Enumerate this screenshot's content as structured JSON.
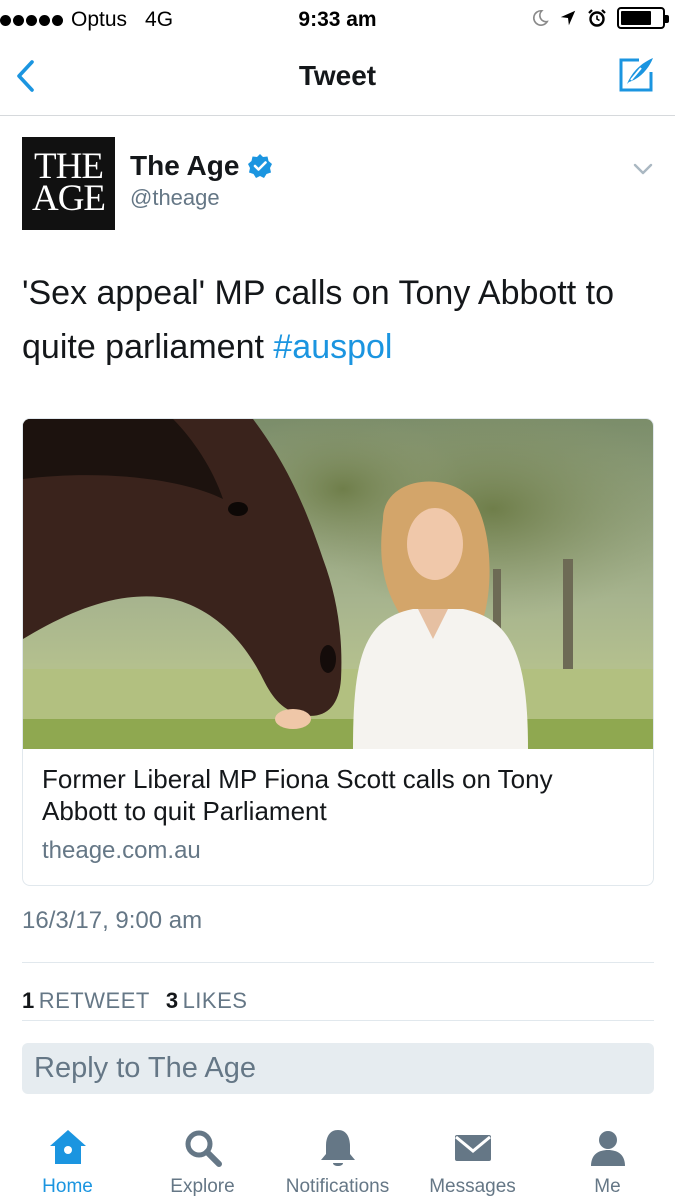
{
  "status_bar": {
    "carrier": "Optus",
    "network": "4G",
    "time": "9:33 am",
    "battery_level": 0.75,
    "icons": [
      "moon-icon",
      "location-arrow-icon",
      "alarm-icon",
      "battery-icon"
    ]
  },
  "nav": {
    "title": "Tweet",
    "back_icon": "chevron-left-icon",
    "compose_icon": "compose-icon"
  },
  "tweet": {
    "avatar_text_line1": "THE",
    "avatar_text_line2": "AGE",
    "author_name": "The Age",
    "author_handle": "@theage",
    "verified": true,
    "text_main": "'Sex appeal' MP calls on Tony Abbott to quite parliament",
    "hashtag": "#auspol",
    "timestamp": "16/3/17, 9:00 am",
    "retweet_count": "1",
    "retweet_label": "RETWEET",
    "like_count": "3",
    "like_label": "LIKES"
  },
  "card": {
    "title": "Former Liberal MP Fiona Scott calls on Tony Abbott to quit Parliament",
    "domain": "theage.com.au"
  },
  "reply": {
    "placeholder": "Reply to The Age"
  },
  "tabs": [
    {
      "label": "Home",
      "icon": "home-icon",
      "active": true
    },
    {
      "label": "Explore",
      "icon": "search-icon",
      "active": false
    },
    {
      "label": "Notifications",
      "icon": "bell-icon",
      "active": false
    },
    {
      "label": "Messages",
      "icon": "envelope-icon",
      "active": false
    },
    {
      "label": "Me",
      "icon": "person-icon",
      "active": false
    }
  ],
  "colors": {
    "accent": "#1b95e0",
    "secondary_text": "#657786",
    "divider": "#e1e8ed",
    "reply_bg": "#e6ecf0"
  }
}
